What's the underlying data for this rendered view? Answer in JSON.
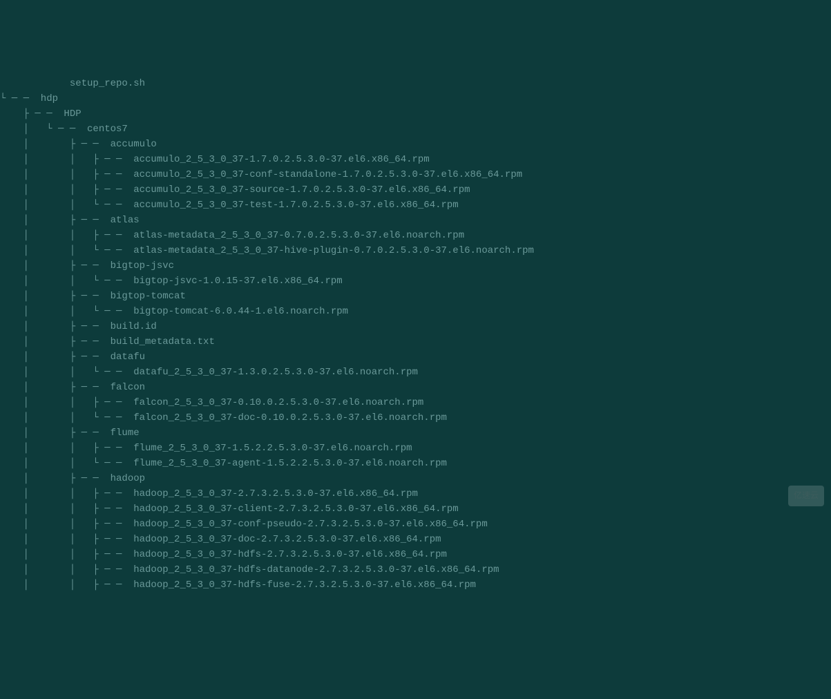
{
  "tree": {
    "lines": [
      "            setup_repo.sh",
      "└── hdp",
      "    ├── HDP",
      "    │   └── centos7",
      "    │       ├── accumulo",
      "    │       │   ├── accumulo_2_5_3_0_37-1.7.0.2.5.3.0-37.el6.x86_64.rpm",
      "    │       │   ├── accumulo_2_5_3_0_37-conf-standalone-1.7.0.2.5.3.0-37.el6.x86_64.rpm",
      "    │       │   ├── accumulo_2_5_3_0_37-source-1.7.0.2.5.3.0-37.el6.x86_64.rpm",
      "    │       │   └── accumulo_2_5_3_0_37-test-1.7.0.2.5.3.0-37.el6.x86_64.rpm",
      "    │       ├── atlas",
      "    │       │   ├── atlas-metadata_2_5_3_0_37-0.7.0.2.5.3.0-37.el6.noarch.rpm",
      "    │       │   └── atlas-metadata_2_5_3_0_37-hive-plugin-0.7.0.2.5.3.0-37.el6.noarch.rpm",
      "    │       ├── bigtop-jsvc",
      "    │       │   └── bigtop-jsvc-1.0.15-37.el6.x86_64.rpm",
      "    │       ├── bigtop-tomcat",
      "    │       │   └── bigtop-tomcat-6.0.44-1.el6.noarch.rpm",
      "    │       ├── build.id",
      "    │       ├── build_metadata.txt",
      "    │       ├── datafu",
      "    │       │   └── datafu_2_5_3_0_37-1.3.0.2.5.3.0-37.el6.noarch.rpm",
      "    │       ├── falcon",
      "    │       │   ├── falcon_2_5_3_0_37-0.10.0.2.5.3.0-37.el6.noarch.rpm",
      "    │       │   └── falcon_2_5_3_0_37-doc-0.10.0.2.5.3.0-37.el6.noarch.rpm",
      "    │       ├── flume",
      "    │       │   ├── flume_2_5_3_0_37-1.5.2.2.5.3.0-37.el6.noarch.rpm",
      "    │       │   └── flume_2_5_3_0_37-agent-1.5.2.2.5.3.0-37.el6.noarch.rpm",
      "    │       ├── hadoop",
      "    │       │   ├── hadoop_2_5_3_0_37-2.7.3.2.5.3.0-37.el6.x86_64.rpm",
      "    │       │   ├── hadoop_2_5_3_0_37-client-2.7.3.2.5.3.0-37.el6.x86_64.rpm",
      "    │       │   ├── hadoop_2_5_3_0_37-conf-pseudo-2.7.3.2.5.3.0-37.el6.x86_64.rpm",
      "    │       │   ├── hadoop_2_5_3_0_37-doc-2.7.3.2.5.3.0-37.el6.x86_64.rpm",
      "    │       │   ├── hadoop_2_5_3_0_37-hdfs-2.7.3.2.5.3.0-37.el6.x86_64.rpm",
      "    │       │   ├── hadoop_2_5_3_0_37-hdfs-datanode-2.7.3.2.5.3.0-37.el6.x86_64.rpm",
      "    │       │   ├── hadoop_2_5_3_0_37-hdfs-fuse-2.7.3.2.5.3.0-37.el6.x86_64.rpm"
    ]
  },
  "watermark": "亿速云"
}
